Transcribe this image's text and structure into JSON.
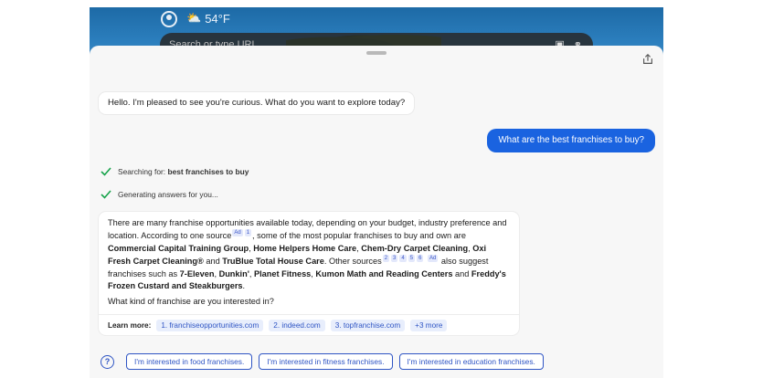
{
  "browser_background": {
    "weather_temp": "54°F",
    "url_placeholder": "Search or type URL"
  },
  "conversation": {
    "greeting": "Hello. I'm pleased to see you're curious. What do you want to explore today?",
    "user_message": "What are the best franchises to buy?",
    "status": [
      {
        "prefix": "Searching for: ",
        "bold": "best franchises to buy"
      },
      {
        "prefix": "Generating answers for you...",
        "bold": ""
      }
    ],
    "answer": {
      "p1_a": "There are many franchise opportunities available today, depending on your budget, industry preference and location. According to one source",
      "sup_ad": "Ad",
      "sup_1": "1",
      "p1_b": ", some of the most popular franchises to buy and own are ",
      "f1": "Commercial Capital Training Group",
      "sep1": ", ",
      "f2": "Home Helpers Home Care",
      "sep2": ", ",
      "f3": "Chem-Dry Carpet Cleaning",
      "sep3": ", ",
      "f4": "Oxi Fresh Carpet Cleaning®",
      "and1": " and ",
      "f5": "TruBlue Total House Care",
      "p2_a": ". Other sources",
      "sups2": [
        "2",
        "3",
        "4",
        "5",
        "6"
      ],
      "sup_ad2": "Ad",
      "p2_b": " also suggest franchises such as ",
      "g1": "7-Eleven",
      "gsep1": ", ",
      "g2": "Dunkin'",
      "gsep2": ", ",
      "g3": "Planet Fitness",
      "gsep3": ", ",
      "g4": "Kumon Math and Reading Centers",
      "and2": " and ",
      "g5": "Freddy's Frozen Custard and Steakburgers",
      "end": ".",
      "question": "What kind of franchise are you interested in?"
    },
    "learn_more": {
      "label": "Learn more:",
      "links": [
        "1. franchiseopportunities.com",
        "2. indeed.com",
        "3. topfranchise.com",
        "+3 more"
      ]
    },
    "suggestions": [
      "I'm interested in food franchises.",
      "I'm interested in fitness franchises.",
      "I'm interested in education franchises."
    ]
  },
  "colors": {
    "accent": "#1a63e0",
    "link": "#2f55c4",
    "check": "#16a34a"
  }
}
